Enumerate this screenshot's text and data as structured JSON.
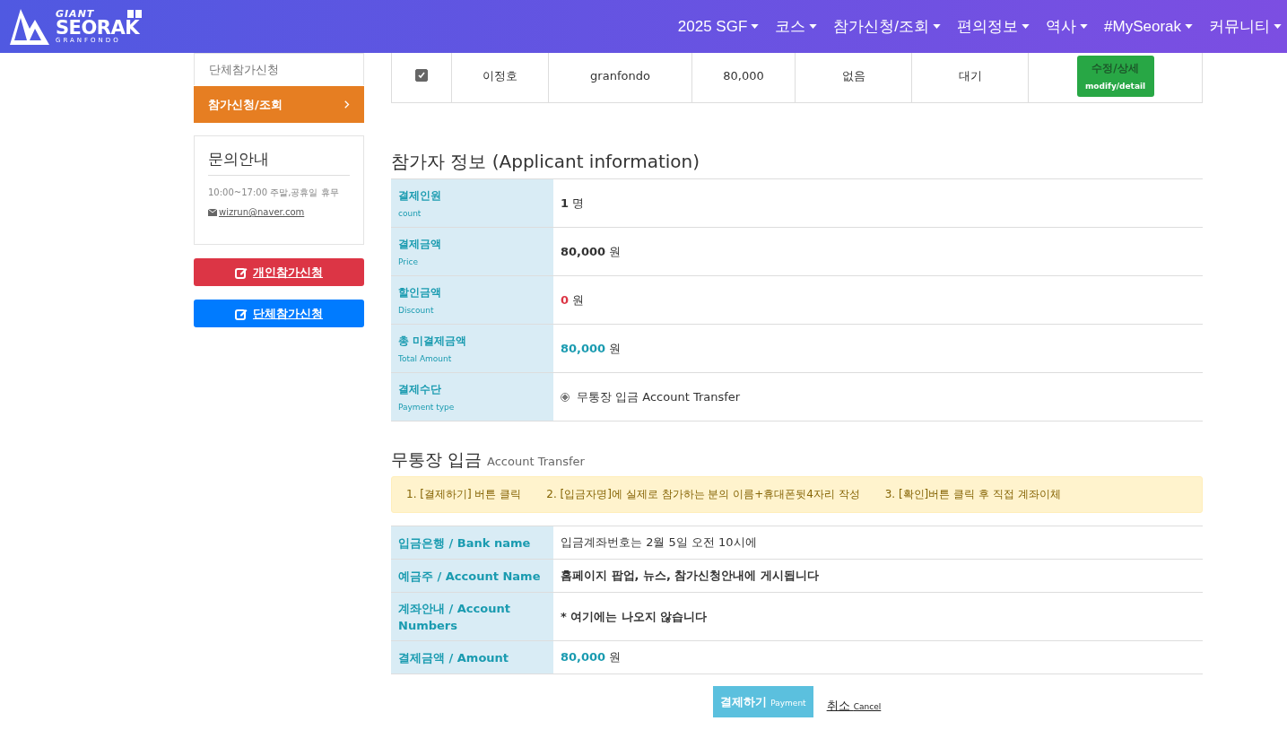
{
  "nav": {
    "logo": {
      "brand": "GIANT",
      "name": "SEORAK",
      "sub": "GRANFONDO"
    },
    "menu": [
      {
        "label": "2025 SGF"
      },
      {
        "label": "코스"
      },
      {
        "label": "참가신청/조회"
      },
      {
        "label": "편의정보"
      },
      {
        "label": "역사"
      },
      {
        "label": "#MySeorak"
      },
      {
        "label": "커뮤니티"
      }
    ]
  },
  "sidebar": {
    "items": [
      {
        "label": "단체참가신청",
        "selected": false
      },
      {
        "label": "참가신청/조회",
        "selected": true
      }
    ],
    "contact": {
      "title": "문의안내",
      "hours": "10:00~17:00 주말,공휴일 휴무",
      "email": "wizrun@naver.com"
    },
    "buttons": [
      {
        "label": "개인참가신청",
        "kind": "danger"
      },
      {
        "label": "단체참가신청",
        "kind": "primary"
      }
    ]
  },
  "entries": {
    "rows": [
      {
        "checked": true,
        "cells": [
          "이정호",
          "granfondo",
          "80,000",
          "없음",
          "대기"
        ],
        "action": {
          "label": "수정/상세",
          "sub": "modify/detail"
        }
      }
    ]
  },
  "applicant": {
    "title": "참가자 정보 (Applicant information)",
    "rows": [
      {
        "label": "결제인원",
        "sub": "count",
        "kind": "bold",
        "value": "1",
        "unit": "명"
      },
      {
        "label": "결제금액",
        "sub": "Price",
        "kind": "bold",
        "value": "80,000",
        "unit": "원"
      },
      {
        "label": "할인금액",
        "sub": "Discount",
        "kind": "alert",
        "value": "0",
        "unit": "원"
      },
      {
        "label": "총 미결제금액",
        "sub": "Total Amount",
        "kind": "accent",
        "value": "80,000",
        "unit": "원"
      },
      {
        "label": "결제수단",
        "sub": "Payment type",
        "kind": "radio",
        "value": "무통장 입금 Account Transfer",
        "selected": true
      }
    ]
  },
  "transfer": {
    "title": "무통장 입금",
    "subtitle": "Account Transfer",
    "steps": [
      "1. [결제하기] 버튼 클릭",
      "2. [입금자명]에 실제로 참가하는 분의 이름+휴대폰뒷4자리 작성",
      "3. [확인]버튼 클릭 후 직접 계좌이체"
    ],
    "rows": [
      {
        "label": "입금은행 / Bank name",
        "kind": "text",
        "value": "입금계좌번호는 2월 5일 오전 10시에"
      },
      {
        "label": "예금주 / Account Name",
        "kind": "bold",
        "value": "홈페이지 팝업, 뉴스, 참가신청안내에 게시됩니다"
      },
      {
        "label": "계좌안내 / Account Numbers",
        "kind": "bold",
        "value": "* 여기에는 나오지 않습니다"
      },
      {
        "label": "결제금액 / Amount",
        "kind": "accent",
        "value": "80,000",
        "unit": "원"
      }
    ]
  },
  "actions": {
    "pay": {
      "label": "결제하기",
      "sub": "Payment"
    },
    "cancel": {
      "label": "취소",
      "sub": "Cancel"
    }
  }
}
